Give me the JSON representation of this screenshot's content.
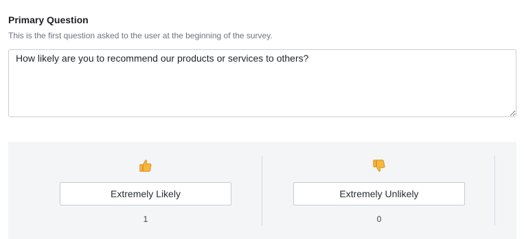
{
  "section": {
    "title": "Primary Question",
    "description": "This is the first question asked to the user at the beginning of the survey."
  },
  "question": {
    "value": "How likely are you to recommend our products or services to others?"
  },
  "answers": [
    {
      "icon": "thumbs-up-icon",
      "label": "Extremely Likely",
      "count": "1"
    },
    {
      "icon": "thumbs-down-icon",
      "label": "Extremely Unlikely",
      "count": "0"
    }
  ],
  "colors": {
    "icon_fill": "#f6b73c",
    "icon_stroke": "#d98d1a",
    "panel_bg": "#f3f5f7"
  }
}
